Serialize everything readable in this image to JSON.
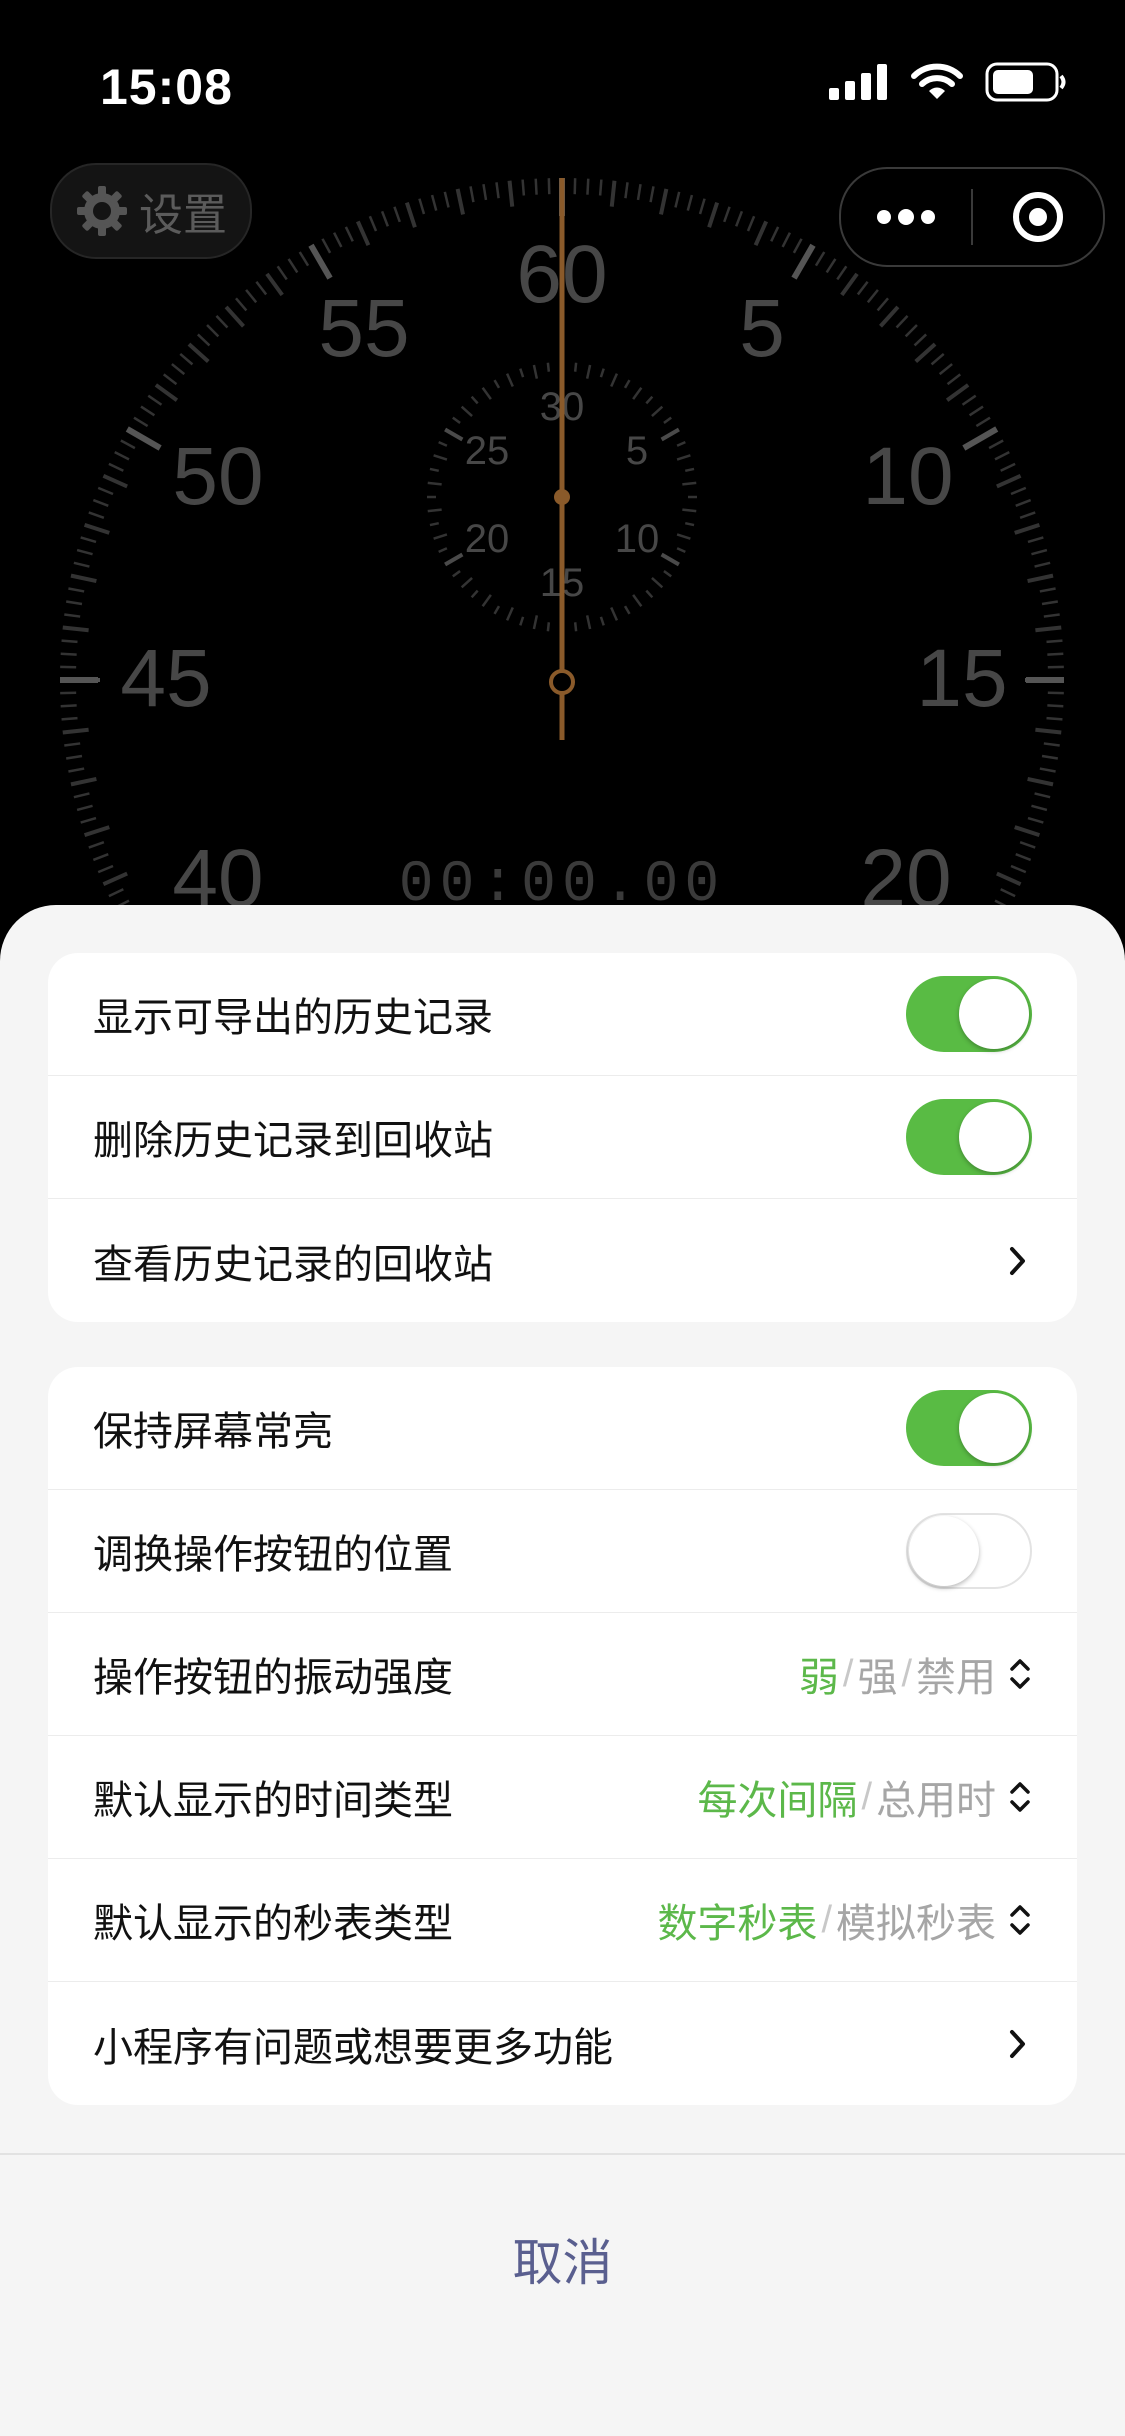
{
  "status_bar": {
    "time": "15:08"
  },
  "top": {
    "settings_label": "设置"
  },
  "stopwatch": {
    "digital_time": "00:00.00",
    "outer_labels": [
      "60",
      "5",
      "10",
      "15",
      "20",
      "40",
      "45",
      "50",
      "55"
    ],
    "inner_labels": [
      "30",
      "5",
      "10",
      "15",
      "20",
      "25"
    ]
  },
  "group1": {
    "items": [
      {
        "label": "显示可导出的历史记录",
        "control": "toggle",
        "on": true
      },
      {
        "label": "删除历史记录到回收站",
        "control": "toggle",
        "on": true
      },
      {
        "label": "查看历史记录的回收站",
        "control": "chevron"
      }
    ]
  },
  "group2": {
    "items": [
      {
        "label": "保持屏幕常亮",
        "control": "toggle",
        "on": true
      },
      {
        "label": "调换操作按钮的位置",
        "control": "toggle",
        "on": false
      },
      {
        "label": "操作按钮的振动强度",
        "control": "segmented",
        "options": [
          "弱",
          "强",
          "禁用"
        ],
        "selected": 0
      },
      {
        "label": "默认显示的时间类型",
        "control": "segmented",
        "options": [
          "每次间隔",
          "总用时"
        ],
        "selected": 0
      },
      {
        "label": "默认显示的秒表类型",
        "control": "segmented",
        "options": [
          "数字秒表",
          "模拟秒表"
        ],
        "selected": 0
      },
      {
        "label": "小程序有问题或想要更多功能",
        "control": "chevron"
      }
    ]
  },
  "cancel_label": "取消",
  "colors": {
    "accent_green": "#5cb84a",
    "toggle_green": "#59bb44",
    "cancel_text": "#5a5f8f"
  }
}
